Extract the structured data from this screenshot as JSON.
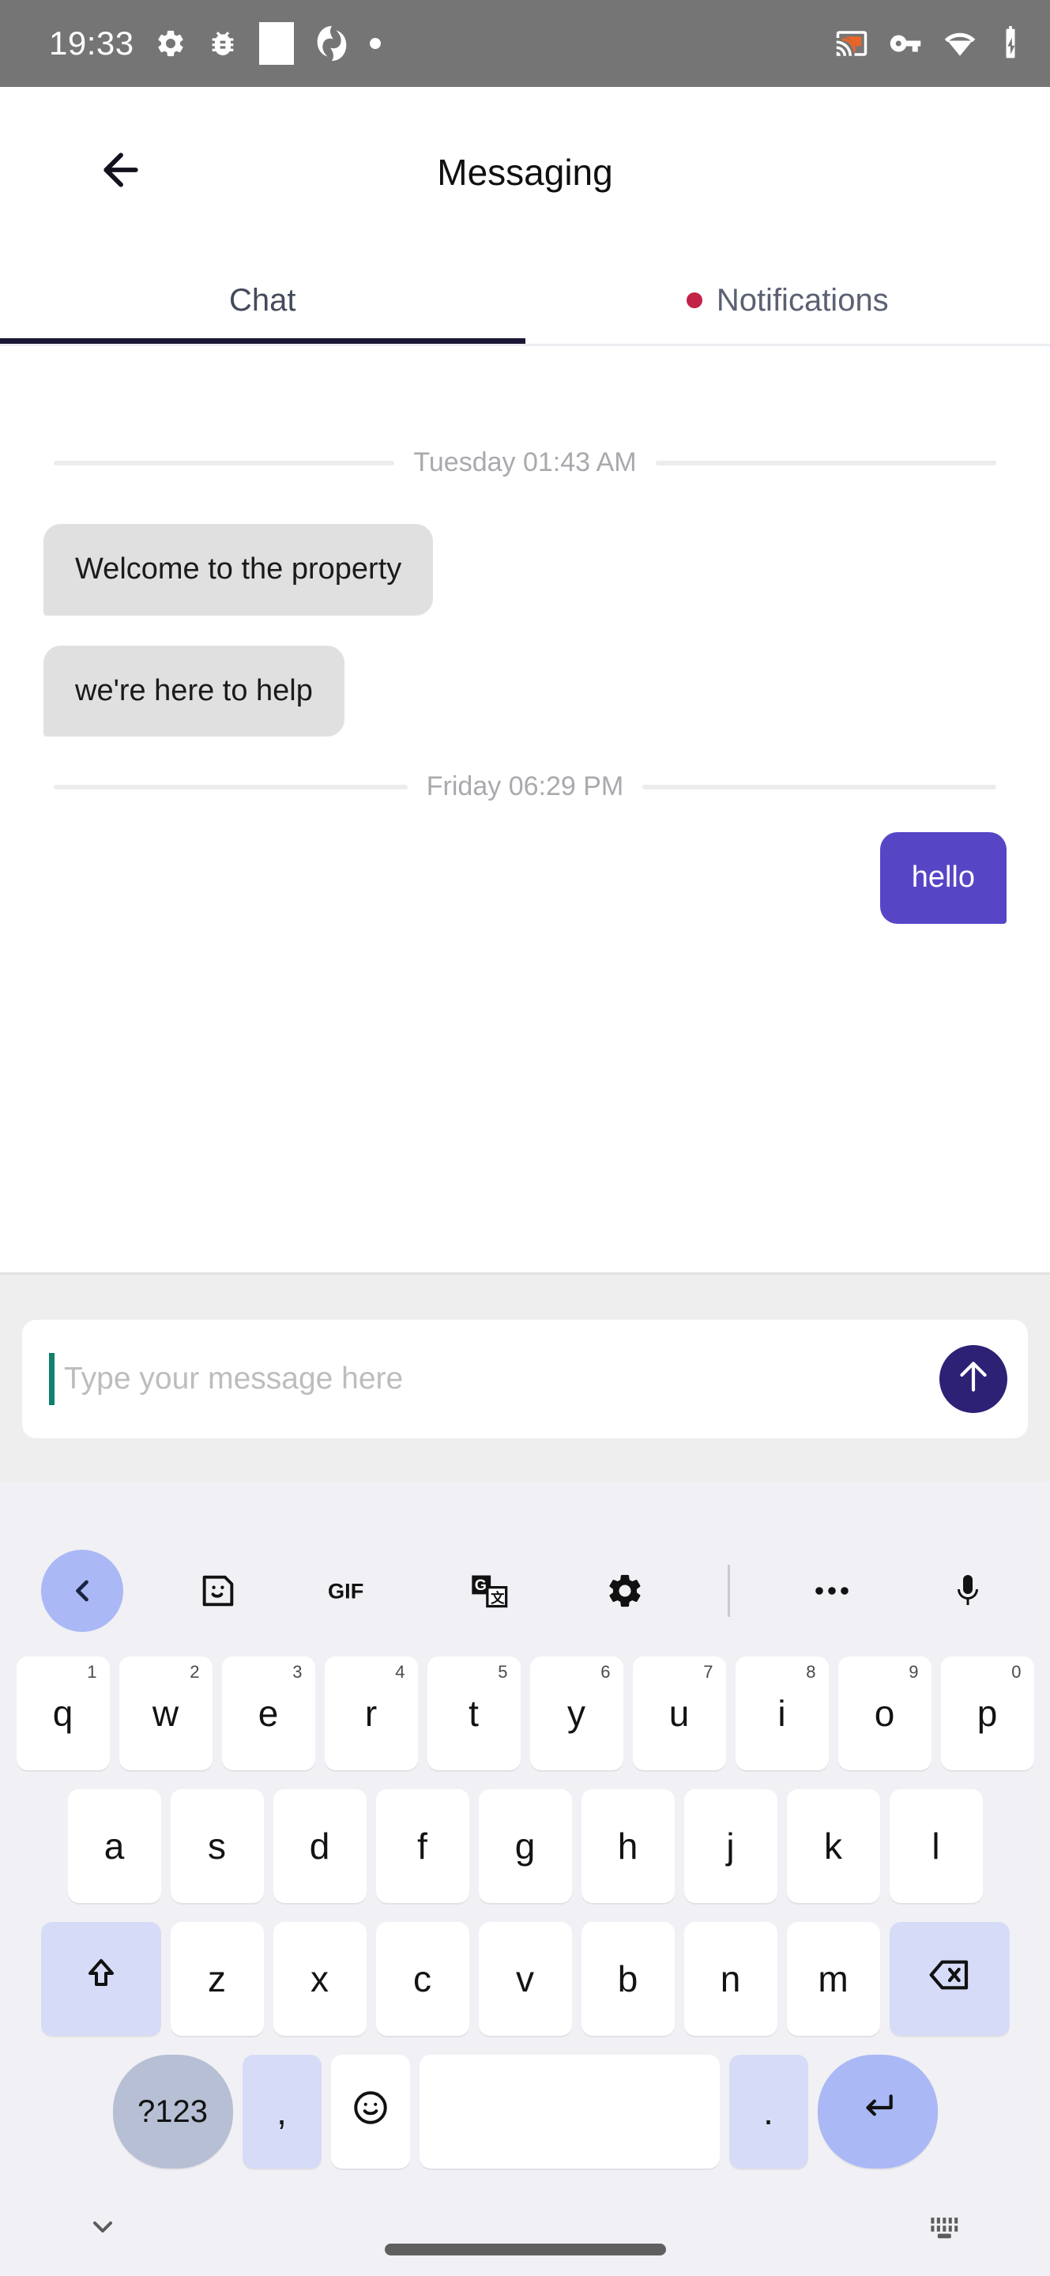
{
  "status_bar": {
    "time": "19:33",
    "left_icons": [
      "gear-icon",
      "bug-icon",
      "white-square-icon",
      "spiral-logo-icon",
      "dot-icon"
    ],
    "right_icons": [
      "cast-icon",
      "vpn-key-icon",
      "wifi-icon",
      "battery-charging-icon"
    ],
    "background": "#757575"
  },
  "header": {
    "back_icon": "arrow-left-icon",
    "title": "Messaging"
  },
  "tabs": {
    "items": [
      {
        "label": "Chat",
        "active": true,
        "badge": false
      },
      {
        "label": "Notifications",
        "active": false,
        "badge": true
      }
    ],
    "indicator_color": "#1a1635",
    "badge_color": "#c32347"
  },
  "chat": {
    "groups": [
      {
        "divider": "Tuesday 01:43 AM",
        "messages": [
          {
            "text": "Welcome to the property",
            "direction": "in"
          },
          {
            "text": "we're here to help",
            "direction": "in"
          }
        ]
      },
      {
        "divider": "Friday 06:29 PM",
        "messages": [
          {
            "text": "hello",
            "direction": "out"
          }
        ]
      }
    ],
    "incoming_bubble_color": "#e0e0e0",
    "outgoing_bubble_color": "#5646c6"
  },
  "composer": {
    "placeholder": "Type your message here",
    "value": "",
    "caret_color": "#11806e",
    "send_icon": "arrow-up-icon",
    "send_button_color": "#2d2175"
  },
  "keyboard": {
    "toolbar": [
      {
        "name": "chevron-left-icon",
        "selected": true
      },
      {
        "name": "sticker-icon",
        "selected": false
      },
      {
        "name": "gif-icon",
        "label": "GIF",
        "selected": false
      },
      {
        "name": "translate-icon",
        "selected": false
      },
      {
        "name": "gear-icon",
        "selected": false
      },
      {
        "name": "divider",
        "selected": false
      },
      {
        "name": "more-dots-icon",
        "selected": false
      },
      {
        "name": "microphone-icon",
        "selected": false
      }
    ],
    "row1": [
      {
        "key": "q",
        "hint": "1"
      },
      {
        "key": "w",
        "hint": "2"
      },
      {
        "key": "e",
        "hint": "3"
      },
      {
        "key": "r",
        "hint": "4"
      },
      {
        "key": "t",
        "hint": "5"
      },
      {
        "key": "y",
        "hint": "6"
      },
      {
        "key": "u",
        "hint": "7"
      },
      {
        "key": "i",
        "hint": "8"
      },
      {
        "key": "o",
        "hint": "9"
      },
      {
        "key": "p",
        "hint": "0"
      }
    ],
    "row2": [
      {
        "key": "a"
      },
      {
        "key": "s"
      },
      {
        "key": "d"
      },
      {
        "key": "f"
      },
      {
        "key": "g"
      },
      {
        "key": "h"
      },
      {
        "key": "j"
      },
      {
        "key": "k"
      },
      {
        "key": "l"
      }
    ],
    "row3": [
      {
        "key": "shift-icon",
        "type": "fn"
      },
      {
        "key": "z"
      },
      {
        "key": "x"
      },
      {
        "key": "c"
      },
      {
        "key": "v"
      },
      {
        "key": "b"
      },
      {
        "key": "n"
      },
      {
        "key": "m"
      },
      {
        "key": "backspace-icon",
        "type": "fn"
      }
    ],
    "row4": [
      {
        "key": "?123",
        "type": "fn-dark"
      },
      {
        "key": ",",
        "type": "fn"
      },
      {
        "key": "emoji-icon",
        "type": "normal"
      },
      {
        "key": "space",
        "type": "space"
      },
      {
        "key": ".",
        "type": "fn"
      },
      {
        "key": "enter-icon",
        "type": "enter"
      }
    ],
    "bottom_bar": {
      "left_icon": "chevron-down-icon",
      "right_icon": "keyboard-switch-icon"
    }
  }
}
